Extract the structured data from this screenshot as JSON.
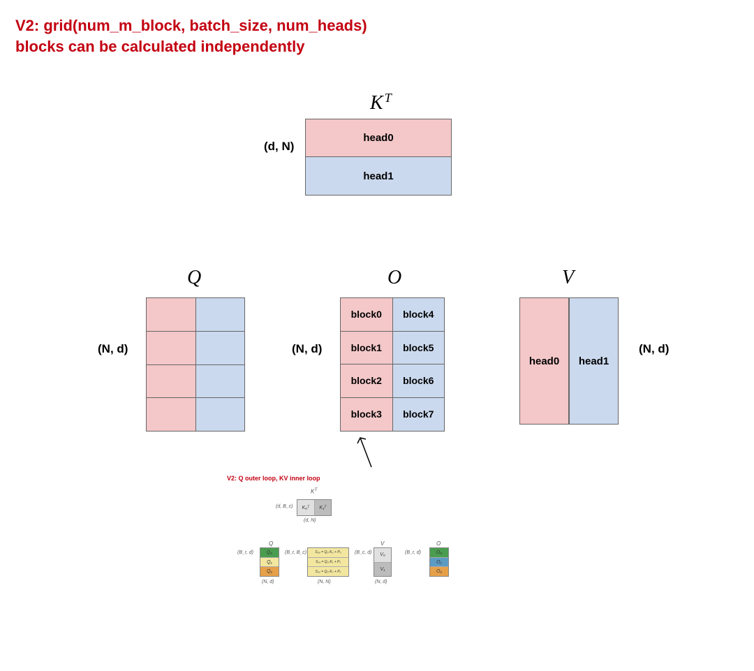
{
  "title_line1": "V2: grid(num_m_block, batch_size, num_heads)",
  "title_line2": "blocks can be calculated independently",
  "kt": {
    "label": "K",
    "sup": "T",
    "dim": "(d, N)",
    "heads": [
      "head0",
      "head1"
    ]
  },
  "q": {
    "label": "Q",
    "dim": "(N, d)"
  },
  "o": {
    "label": "O",
    "dim": "(N, d)",
    "blocks_col0": [
      "block0",
      "block1",
      "block2",
      "block3"
    ],
    "blocks_col1": [
      "block4",
      "block5",
      "block6",
      "block7"
    ]
  },
  "v": {
    "label": "V",
    "dim": "(N, d)",
    "heads": [
      "head0",
      "head1"
    ]
  },
  "inner": {
    "title": "V2: Q outer loop, KV inner loop",
    "kt_label": "K",
    "kt_sup": "T",
    "kt_cells": [
      "K₀ᵀ",
      "K₁ᵀ"
    ],
    "kt_dim_top": "(d, B_c)",
    "kt_dim_bottom": "(d, N)",
    "q_label": "Q",
    "q_dim_left": "(B_r, d)",
    "q_dim_bottom": "(N, d)",
    "q_cells": [
      "Q₀",
      "Q₁",
      "Q₂"
    ],
    "s_dim_left": "(B_r, B_c)",
    "s_dim_bottom": "(N, N)",
    "s_cells": [
      "S₀₀ = Q₀·K₀ + P₀",
      "S₀₁ = Q₀·K₁ + P₁",
      "S₀₂ = Q₀·K₂ + P₂"
    ],
    "v_label": "V",
    "v_dim_left": "(B_c, d)",
    "v_dim_bottom": "(N, d)",
    "v_cells": [
      "V₀",
      "V₁"
    ],
    "o_label": "O",
    "o_dim_left": "(B_r, d)",
    "o_cells": [
      "O₀",
      "O₁",
      "O₂"
    ]
  }
}
